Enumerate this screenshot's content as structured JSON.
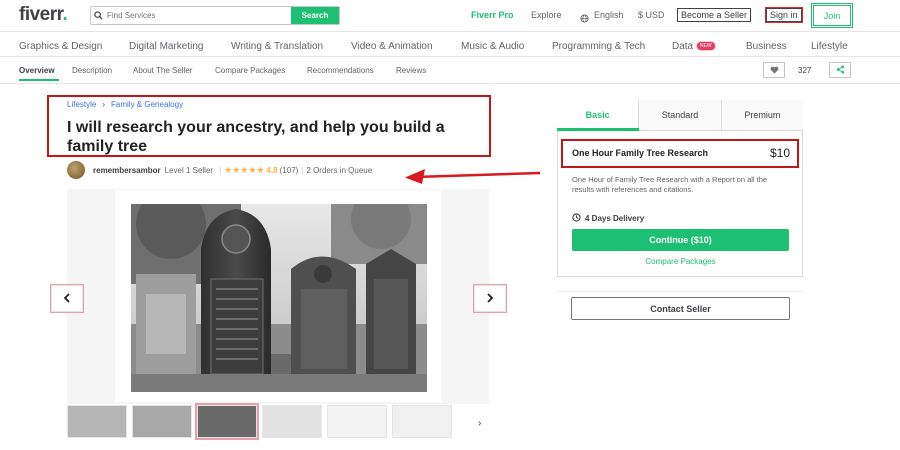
{
  "header": {
    "logo": "fiverr",
    "logo_dot": ".",
    "search_placeholder": "Find Services",
    "search_button": "Search",
    "nav": [
      "Fiverr Pro",
      "Explore",
      "English",
      "$ USD"
    ],
    "become_seller": "Become a Seller",
    "sign_in": "Sign in",
    "join": "Join"
  },
  "categories": [
    "Graphics & Design",
    "Digital Marketing",
    "Writing & Translation",
    "Video & Animation",
    "Music & Audio",
    "Programming & Tech",
    "Data",
    "Business",
    "Lifestyle"
  ],
  "data_badge": "NEW",
  "subnav": {
    "items": [
      "Overview",
      "Description",
      "About The Seller",
      "Compare Packages",
      "Recommendations",
      "Reviews"
    ],
    "save_count": "327"
  },
  "gig": {
    "breadcrumb": [
      "Lifestyle",
      "Family & Genealogy"
    ],
    "title": "I will research your ancestry, and help you build a family tree",
    "seller_name": "remembersambor",
    "seller_level": "Level 1 Seller",
    "stars": "★★★★★",
    "rating": "4.8",
    "reviews": "(107)",
    "queue": "2 Orders in Queue"
  },
  "package": {
    "tabs": [
      "Basic",
      "Standard",
      "Premium"
    ],
    "name": "One Hour Family Tree Research",
    "price": "$10",
    "description": "One Hour of Family Tree Research with a Report on all the results with references and citations.",
    "delivery": "4 Days Delivery",
    "continue": "Continue ($10)",
    "compare": "Compare Packages",
    "contact": "Contact Seller"
  },
  "colors": {
    "brand_green": "#1dbf73",
    "annotation_red": "#c01818"
  },
  "icons": [
    "search-icon",
    "globe-icon",
    "heart-icon",
    "share-icon",
    "clock-icon",
    "chevron-left-icon",
    "chevron-right-icon",
    "chevron-right-icon"
  ]
}
